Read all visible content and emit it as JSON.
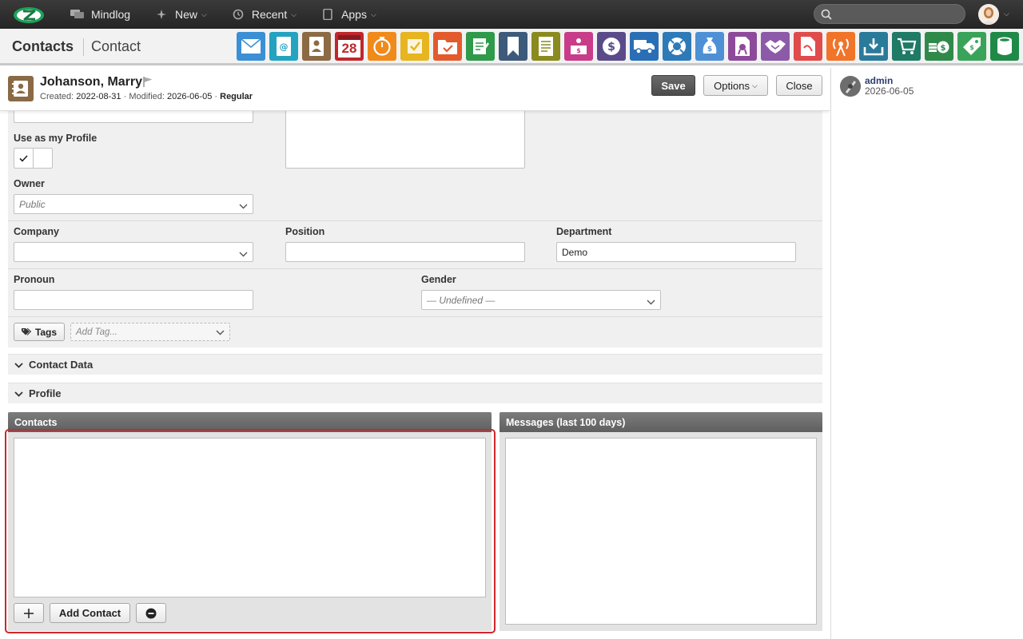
{
  "topbar": {
    "nav": [
      {
        "label": "Mindlog",
        "icon": "chat-icon",
        "has_menu": false
      },
      {
        "label": "New",
        "icon": "sparkle-icon",
        "has_menu": true
      },
      {
        "label": "Recent",
        "icon": "history-icon",
        "has_menu": true
      },
      {
        "label": "Apps",
        "icon": "tablet-icon",
        "has_menu": true
      }
    ],
    "search": {
      "value": "",
      "placeholder": ""
    }
  },
  "module": {
    "title": "Contacts",
    "subtitle": "Contact",
    "apps": [
      {
        "icon": "mail-icon",
        "color": "#3b8fd4"
      },
      {
        "icon": "address-book-icon",
        "color": "#23a3c0"
      },
      {
        "icon": "contacts-icon",
        "color": "#8c6a44"
      },
      {
        "icon": "calendar-icon",
        "color": "#c0262c",
        "text": "28"
      },
      {
        "icon": "stopwatch-icon",
        "color": "#f08a1a"
      },
      {
        "icon": "tasks-icon",
        "color": "#e6b520"
      },
      {
        "icon": "folder-check-icon",
        "color": "#e35b2d"
      },
      {
        "icon": "notes-icon",
        "color": "#2e9a4a"
      },
      {
        "icon": "bookmark-icon",
        "color": "#3d5a7a"
      },
      {
        "icon": "document-icon",
        "color": "#8a8a1f"
      },
      {
        "icon": "reception-icon",
        "color": "#c93c8a"
      },
      {
        "icon": "dollar-icon",
        "color": "#5a4a8a"
      },
      {
        "icon": "truck-icon",
        "color": "#2a6fb5"
      },
      {
        "icon": "support-icon",
        "color": "#2e79b8"
      },
      {
        "icon": "moneybag-icon",
        "color": "#4d90d6"
      },
      {
        "icon": "certificate-icon",
        "color": "#8e4a9a"
      },
      {
        "icon": "handshake-icon",
        "color": "#8c5aa8"
      },
      {
        "icon": "pdf-icon",
        "color": "#e04b4b"
      },
      {
        "icon": "broadcast-icon",
        "color": "#f0742a"
      },
      {
        "icon": "download-icon",
        "color": "#2a7a9a"
      },
      {
        "icon": "cart-icon",
        "color": "#1f7a66"
      },
      {
        "icon": "cash-icon",
        "color": "#2f8a4a"
      },
      {
        "icon": "price-tag-icon",
        "color": "#3aa35a"
      },
      {
        "icon": "database-icon",
        "color": "#1f8a48"
      }
    ]
  },
  "record": {
    "name": "Johanson, Marry",
    "created_label": "Created:",
    "created": "2022-08-31",
    "sep1": "·",
    "modified_label": "Modified:",
    "modified": "2026-06-05",
    "sep2": "·",
    "type": "Regular",
    "save_label": "Save",
    "options_label": "Options",
    "close_label": "Close"
  },
  "sidebar": {
    "user": "admin",
    "date": "2026-06-05"
  },
  "form": {
    "use_profile_label": "Use as my Profile",
    "owner_label": "Owner",
    "owner_value": "Public",
    "company_label": "Company",
    "company_value": "",
    "position_label": "Position",
    "position_value": "",
    "department_label": "Department",
    "department_value": "Demo",
    "pronoun_label": "Pronoun",
    "pronoun_value": "",
    "gender_label": "Gender",
    "gender_value": "— Undefined —",
    "tags_label": "Tags",
    "add_tag_placeholder": "Add Tag..."
  },
  "sections": {
    "contact_data": "Contact Data",
    "profile": "Profile"
  },
  "panels": {
    "contacts_title": "Contacts",
    "messages_title": "Messages (last 100 days)",
    "add_contact_label": "Add Contact"
  }
}
